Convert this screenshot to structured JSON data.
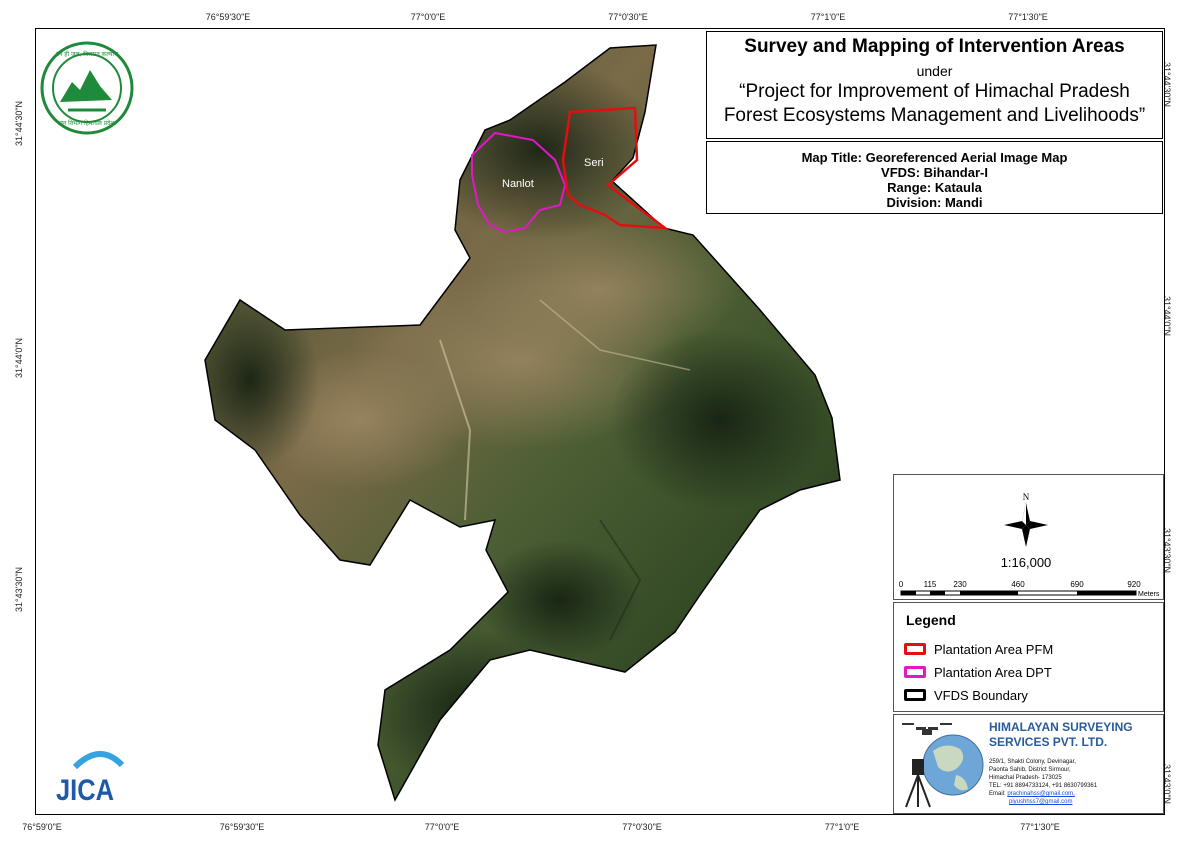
{
  "graticule": {
    "top": [
      "76°59'30\"E",
      "77°0'0\"E",
      "77°0'30\"E",
      "77°1'0\"E",
      "77°1'30\"E"
    ],
    "bottom": [
      "76°59'0\"E",
      "76°59'30\"E",
      "77°0'0\"E",
      "77°0'30\"E",
      "77°1'0\"E",
      "77°1'30\"E"
    ],
    "left": [
      "31°44'30\"N",
      "31°44'0\"N",
      "31°43'30\"N"
    ],
    "right": [
      "31°44'30\"N",
      "31°44'0\"N",
      "31°43'30\"N",
      "31°43'0\"N"
    ]
  },
  "title": {
    "main": "Survey and Mapping of Intervention Areas",
    "under": "under",
    "project_line1": "“Project for Improvement of Himachal Pradesh",
    "project_line2": "Forest Ecosystems Management and Livelihoods”"
  },
  "info": {
    "map_title": "Map Title: Georeferenced Aerial Image Map",
    "vfds": "VFDS: Bihandar-I",
    "range": "Range: Kataula",
    "division": "Division: Mandi"
  },
  "map": {
    "labels": {
      "nanlot": "Nanlot",
      "seri": "Seri"
    }
  },
  "north_arrow": {
    "label": "N"
  },
  "scale": {
    "ratio": "1:16,000",
    "ticks": [
      "0",
      "115",
      "230",
      "460",
      "690",
      "920"
    ],
    "tick_values_m": [
      0,
      115,
      230,
      460,
      690,
      920
    ],
    "unit": "Meters"
  },
  "legend": {
    "title": "Legend",
    "items": [
      {
        "label": "Plantation Area PFM",
        "color": "#e01010"
      },
      {
        "label": "Plantation Area DPT",
        "color": "#e018c8"
      },
      {
        "label": "VFDS Boundary",
        "color": "#000000"
      }
    ]
  },
  "logos": {
    "forest_top": "वन ही जल, विरासत कल्याण",
    "forest_bottom": "वन विभाग हिमाचल प्रदेश",
    "jica": "JICA"
  },
  "company": {
    "name_line1": "HIMALAYAN SURVEYING",
    "name_line2": "SERVICES PVT. LTD.",
    "address": [
      "259/1, Shakti Colony, Devinagar,",
      "Paonta Sahib, District Sirmour,",
      "Himachal Pradesh- 173025",
      "TEL: +91 8894733124, +91 8630799361",
      "Email: "
    ],
    "email1": "prachinahss@gmail.com,",
    "email2": "piyushhss7@gmail.com"
  },
  "colors": {
    "pfm": "#e01010",
    "dpt": "#e018c8",
    "boundary": "#000000",
    "company_blue": "#2a5b9a",
    "logo_green": "#1f8a3a"
  }
}
